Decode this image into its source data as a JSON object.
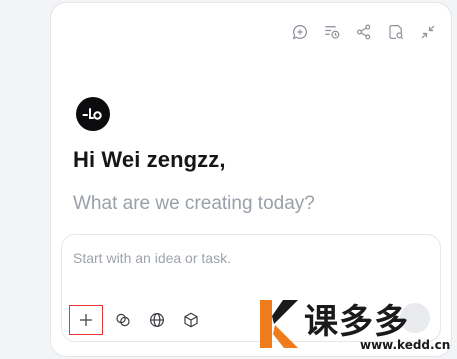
{
  "toolbar": {
    "icons": [
      "add-chat-icon",
      "history-icon",
      "share-icon",
      "notes-icon",
      "collapse-icon"
    ]
  },
  "header": {
    "greeting": "Hi Wei zengzz,",
    "subtitle": "What are we creating today?"
  },
  "composer": {
    "placeholder": "Start with an idea or task.",
    "value": "",
    "tools": [
      "plus-icon",
      "connectors-icon",
      "globe-icon",
      "cube-icon"
    ]
  },
  "watermark": {
    "brand": "课多多",
    "url": "www.kedd.cn"
  },
  "colors": {
    "accent_red": "#e53935",
    "watermark_orange": "#f07b1b",
    "text_dark": "#161616",
    "text_muted": "#9aa0a8"
  }
}
